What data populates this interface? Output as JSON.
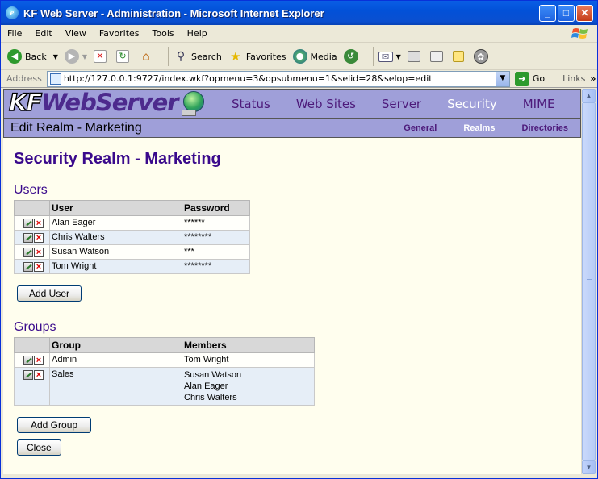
{
  "window": {
    "title": "KF Web Server - Administration - Microsoft Internet Explorer",
    "controls": {
      "minimize": "_",
      "maximize": "□",
      "close": "✕"
    }
  },
  "menubar": {
    "items": [
      "File",
      "Edit",
      "View",
      "Favorites",
      "Tools",
      "Help"
    ]
  },
  "toolbar": {
    "back": "Back",
    "search": "Search",
    "favorites": "Favorites",
    "media": "Media"
  },
  "addressbar": {
    "label": "Address",
    "url": "http://127.0.0.1:9727/index.wkf?opmenu=3&opsubmenu=1&selid=28&selop=edit",
    "go": "Go",
    "links": "Links"
  },
  "app": {
    "logo_prefix": "KF",
    "logo_name": "WebServer",
    "nav": [
      "Status",
      "Web Sites",
      "Server",
      "Security",
      "MIME"
    ],
    "active_nav": "Security",
    "section_title": "Edit Realm - Marketing",
    "subnav": [
      "General",
      "Realms",
      "Directories"
    ],
    "active_subnav": "Realms"
  },
  "page": {
    "title": "Security Realm - Marketing",
    "users": {
      "heading": "Users",
      "columns": [
        "User",
        "Password"
      ],
      "rows": [
        {
          "user": "Alan Eager",
          "password": "******"
        },
        {
          "user": "Chris Walters",
          "password": "********"
        },
        {
          "user": "Susan Watson",
          "password": "***"
        },
        {
          "user": "Tom Wright",
          "password": "********"
        }
      ],
      "add_button": "Add User"
    },
    "groups": {
      "heading": "Groups",
      "columns": [
        "Group",
        "Members"
      ],
      "rows": [
        {
          "group": "Admin",
          "members": [
            "Tom Wright"
          ]
        },
        {
          "group": "Sales",
          "members": [
            "Susan Watson",
            "Alan Eager",
            "Chris Walters"
          ]
        }
      ],
      "add_button": "Add Group"
    },
    "close_button": "Close"
  }
}
